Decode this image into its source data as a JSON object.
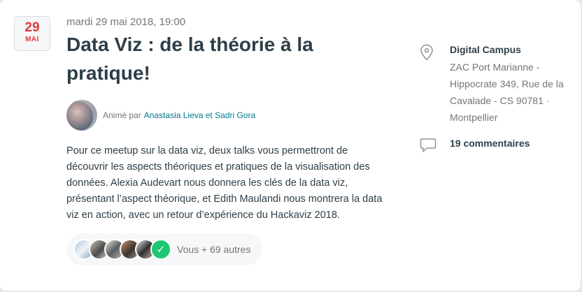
{
  "event": {
    "date_day": "29",
    "date_month": "MAI",
    "datetime": "mardi 29 mai 2018, 19:00",
    "title": "Data Viz : de la théorie à la pratique!",
    "hosted_by_label": "Animé par",
    "hosts": "Anastasia Lieva et Sadri Gora",
    "description": "Pour ce meetup sur la data viz, deux talks vous permettront de découvrir les aspects théoriques et pratiques de la visualisation des données. Alexia Audevart nous donnera les clés de la data viz, présentant l’aspect théorique, et Edith Maulandi nous montrera la data viz en action, avec un retour d’expérience du Hackaviz 2018.",
    "attendees_label": "Vous + 69 autres"
  },
  "venue": {
    "name": "Digital Campus",
    "address": "ZAC Port Marianne - Hippocrate 349, Rue de la Cavalade - CS 90781 · Montpellier"
  },
  "comments": {
    "label": "19 commentaires"
  },
  "icons": {
    "location": "location-pin-icon",
    "comment": "speech-bubble-icon",
    "going": "checkmark-icon"
  },
  "colors": {
    "date_accent": "#e0393e",
    "link": "#00798a",
    "going_green": "#1ec773"
  }
}
